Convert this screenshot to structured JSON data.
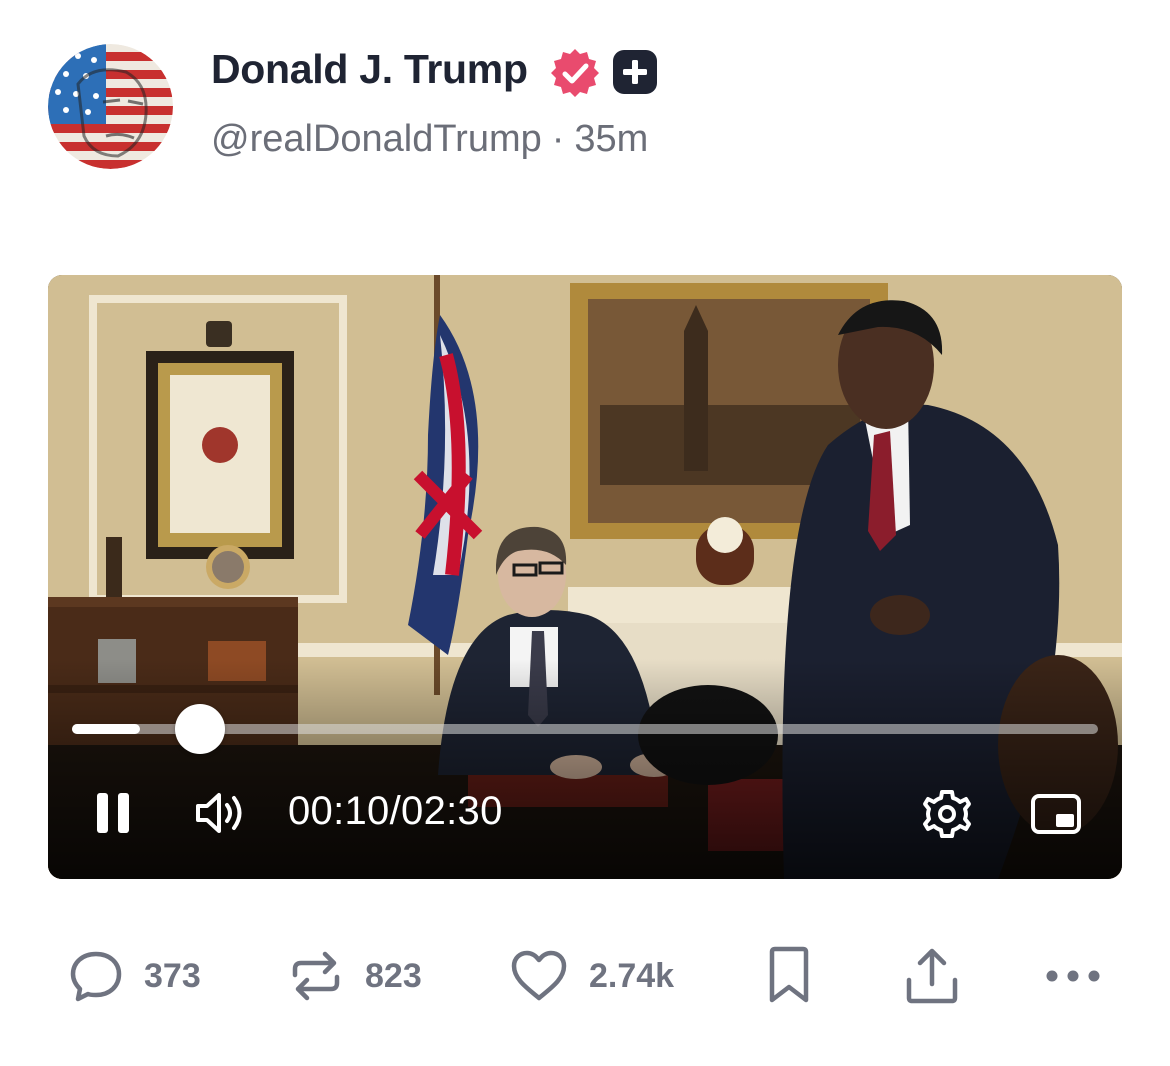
{
  "post": {
    "display_name": "Donald J. Trump",
    "handle": "@realDonaldTrump",
    "separator": "·",
    "time_ago": "35m"
  },
  "video": {
    "progress": 0.0667,
    "current_time": "00:10",
    "time_separator": "/",
    "duration": "02:30",
    "state": "playing"
  },
  "actions": {
    "replies": "373",
    "reposts": "823",
    "likes": "2.74k"
  },
  "colors": {
    "verified_badge": "#e94b6e",
    "text_primary": "#1f2433",
    "text_secondary": "#6b6e78",
    "icon_gray": "#6f7380"
  },
  "icons": {
    "verified": "verified-badge-icon",
    "plus": "plus-badge-icon",
    "pause": "pause-icon",
    "volume": "volume-icon",
    "settings": "gear-icon",
    "pip": "picture-in-picture-icon",
    "reply": "comment-icon",
    "repost": "repost-icon",
    "like": "heart-icon",
    "bookmark": "bookmark-icon",
    "share": "share-icon",
    "more": "more-icon"
  }
}
